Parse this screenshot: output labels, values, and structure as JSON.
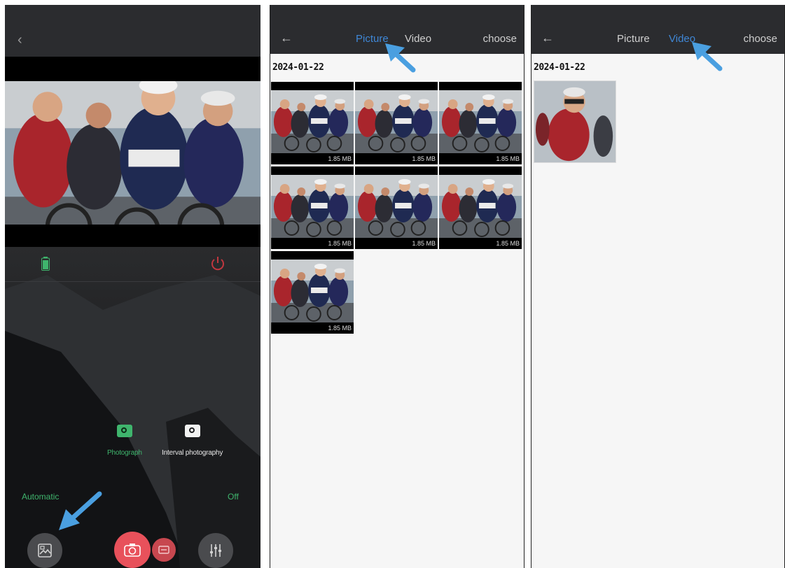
{
  "camera_screen": {
    "modes": {
      "photograph": "Photograph",
      "interval": "Interval photography"
    },
    "automatic_label": "Automatic",
    "off_label": "Off",
    "colors": {
      "accent_green": "#3fb56d",
      "shutter_red": "#e8515b"
    }
  },
  "picture_gallery": {
    "tabs": {
      "picture": "Picture",
      "video": "Video"
    },
    "active_tab": "Picture",
    "choose_label": "choose",
    "date": "2024-01-22",
    "thumbnails": [
      {
        "size": "1.85 MB"
      },
      {
        "size": "1.85 MB"
      },
      {
        "size": "1.85 MB"
      },
      {
        "size": "1.85 MB"
      },
      {
        "size": "1.85 MB"
      },
      {
        "size": "1.85 MB"
      },
      {
        "size": "1.85 MB"
      }
    ]
  },
  "video_gallery": {
    "tabs": {
      "picture": "Picture",
      "video": "Video"
    },
    "active_tab": "Video",
    "choose_label": "choose",
    "date": "2024-01-22",
    "thumbnails": [
      {
        "duration": ""
      }
    ]
  },
  "icons": [
    "back-arrow-icon",
    "battery-icon",
    "power-icon",
    "camera-icon",
    "gallery-icon",
    "shutter-icon",
    "video-icon",
    "settings-sliders-icon",
    "pointer-arrow-icon"
  ],
  "colors": {
    "tab_active": "#3f87d6",
    "arrow_blue": "#4a9fe0",
    "topbar": "#2b2c2f"
  }
}
